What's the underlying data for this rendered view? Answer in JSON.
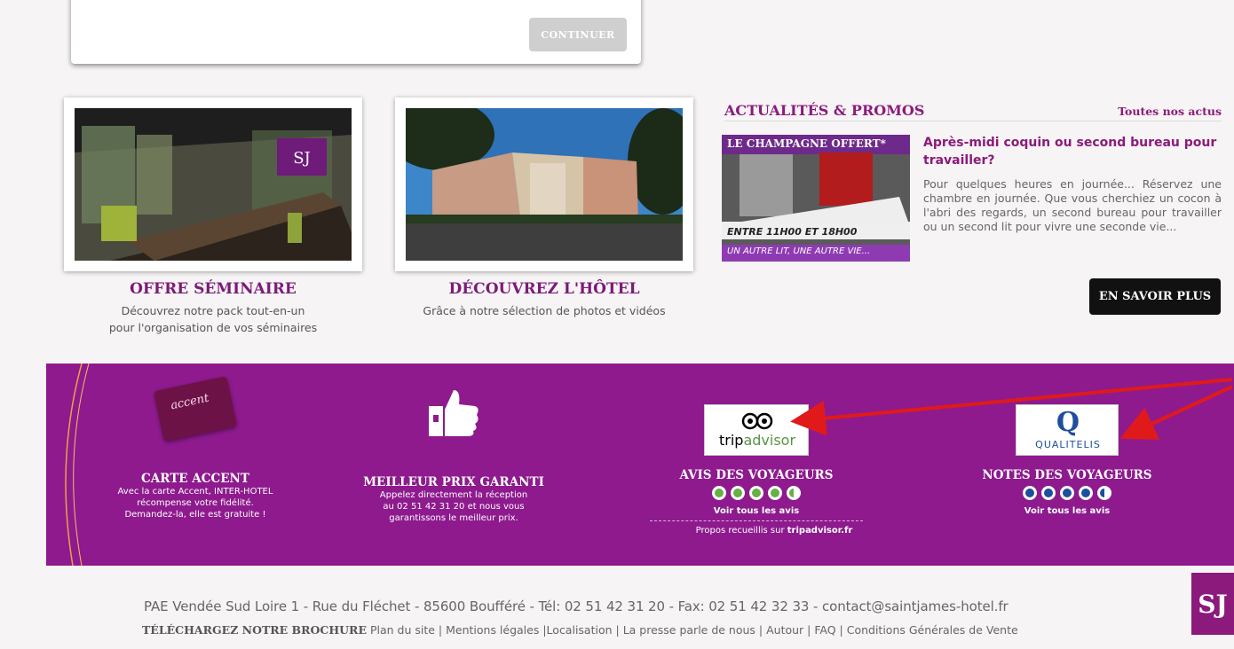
{
  "booking": {
    "continue_label": "CONTINUER"
  },
  "cards": [
    {
      "title": "OFFRE SÉMINAIRE",
      "text1": "Découvrez notre pack tout-en-un",
      "text2": "pour l'organisation de vos séminaires"
    },
    {
      "title": "DÉCOUVREZ L'HÔTEL",
      "text1": "Grâce à notre sélection de photos et vidéos",
      "text2": ""
    }
  ],
  "news": {
    "heading": "ACTUALITÉS & PROMOS",
    "all_link": "Toutes nos actus",
    "image_banner": "LE CHAMPAGNE OFFERT*",
    "image_hours": "ENTRE 11H00 ET 18H00",
    "image_tagline": "UN AUTRE LIT, UNE AUTRE VIE...",
    "item_title": "Après-midi coquin ou second bureau pour travailler?",
    "item_text": "Pour quelques heures en journée... Réservez une chambre en journée. Que vous cherchiez un cocon à l'abri des regards, un second bureau pour travailler ou un second lit pour vivre une seconde vie...",
    "more_label": "EN SAVOIR PLUS"
  },
  "band": {
    "accent": {
      "title": "CARTE ACCENT",
      "lines": [
        "Avec la carte Accent, INTER-HOTEL",
        "récompense votre fidélité.",
        "Demandez-la, elle est gratuite !"
      ],
      "card_text": "accent"
    },
    "price": {
      "title": "MEILLEUR PRIX GARANTI",
      "lines": [
        "Appelez directement la réception",
        "au 02 51 42 31 20 et nous vous",
        "garantissons le meilleur prix."
      ]
    },
    "tripadvisor": {
      "logo_trip": "trip",
      "logo_advisor": "advisor",
      "title": "AVIS DES VOYAGEURS",
      "link": "Voir tous les avis",
      "note_prefix": "Propos recueillis sur",
      "note_site": "tripadvisor.fr"
    },
    "qualitelis": {
      "logo": "QUALITELIS",
      "logo_q": "Q",
      "title": "NOTES DES VOYAGEURS",
      "link": "Voir tous les avis"
    }
  },
  "footer": {
    "address": "PAE Vendée Sud Loire 1 - Rue  du Fléchet - 85600 Boufféré - Tél: 02 51 42 31 20 - Fax: 02 51 42 32 33 - contact@saintjames-hotel.fr",
    "brochure": "TÉLÉCHARGEZ NOTRE BROCHURE",
    "links": "Plan du site | Mentions légales |Localisation | La presse parle de nous | Autour | FAQ | Conditions Générales de Vente",
    "logo": "SJ"
  },
  "colors": {
    "brand": "#8e1a8e",
    "dark": "#111111",
    "tripadvisor_green": "#34e0a1",
    "qualitelis_blue": "#1e4e9c"
  }
}
